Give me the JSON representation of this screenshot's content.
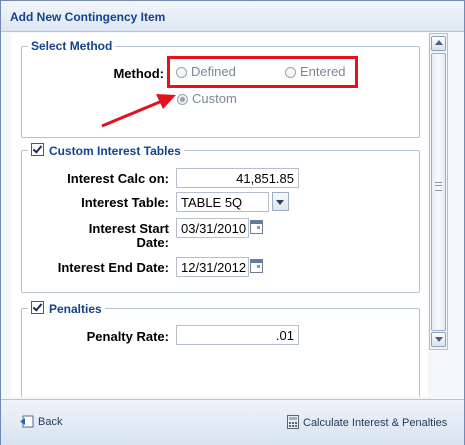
{
  "window": {
    "title": "Add New Contingency Item"
  },
  "select_method": {
    "legend": "Select Method",
    "method_label": "Method:",
    "options": [
      "Defined",
      "Entered",
      "Custom"
    ],
    "selected": "Custom"
  },
  "interest": {
    "legend": "Custom Interest Tables",
    "checked": true,
    "calc_on_label": "Interest Calc on:",
    "calc_on_value": "41,851.85",
    "table_label": "Interest Table:",
    "table_value": "TABLE 5Q",
    "start_label_line1": "Interest Start",
    "start_label_line2": "Date:",
    "start_value": "03/31/2010",
    "end_label": "Interest End Date:",
    "end_value": "12/31/2012"
  },
  "penalties": {
    "legend": "Penalties",
    "checked": true,
    "rate_label": "Penalty Rate:",
    "rate_value": ".01"
  },
  "footer": {
    "back_label": "Back",
    "calculate_label": "Calculate Interest & Penalties"
  },
  "colors": {
    "title": "#15428b",
    "annotation": "#e4121c"
  }
}
